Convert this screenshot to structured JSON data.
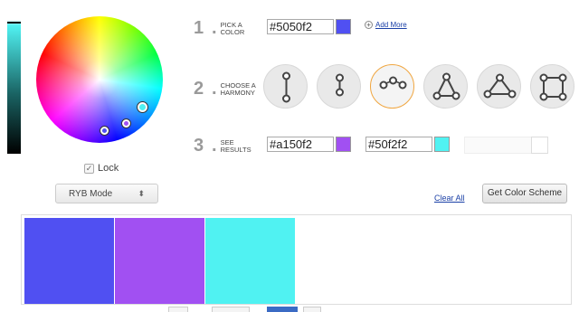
{
  "colors": {
    "primary": "#5050f2",
    "second": "#a150f2",
    "third": "#50f2f2"
  },
  "picker": {
    "lock_label": "Lock",
    "lock_checked": true,
    "mode_label": "RYB Mode",
    "mode_arrow": "⬍"
  },
  "steps": [
    {
      "number": "1",
      "label": "PICK A COLOR"
    },
    {
      "number": "2",
      "label": "CHOOSE A HARMONY"
    },
    {
      "number": "3",
      "label": "SEE RESULTS"
    }
  ],
  "pick": {
    "hex_value": "#5050f2",
    "add_more_label": "Add More"
  },
  "harmonies": [
    {
      "name": "complementary",
      "selected": false
    },
    {
      "name": "split-complementary",
      "selected": false
    },
    {
      "name": "analogous",
      "selected": true
    },
    {
      "name": "triadic",
      "selected": false
    },
    {
      "name": "triadic-alt",
      "selected": false
    },
    {
      "name": "square",
      "selected": false
    }
  ],
  "results": {
    "hex_1": "#a150f2",
    "hex_2": "#50f2f2"
  },
  "actions": {
    "clear_all": "Clear All",
    "get_scheme": "Get Color Scheme"
  },
  "result_swatches": [
    "#5050f2",
    "#a150f2",
    "#50f2f2"
  ]
}
